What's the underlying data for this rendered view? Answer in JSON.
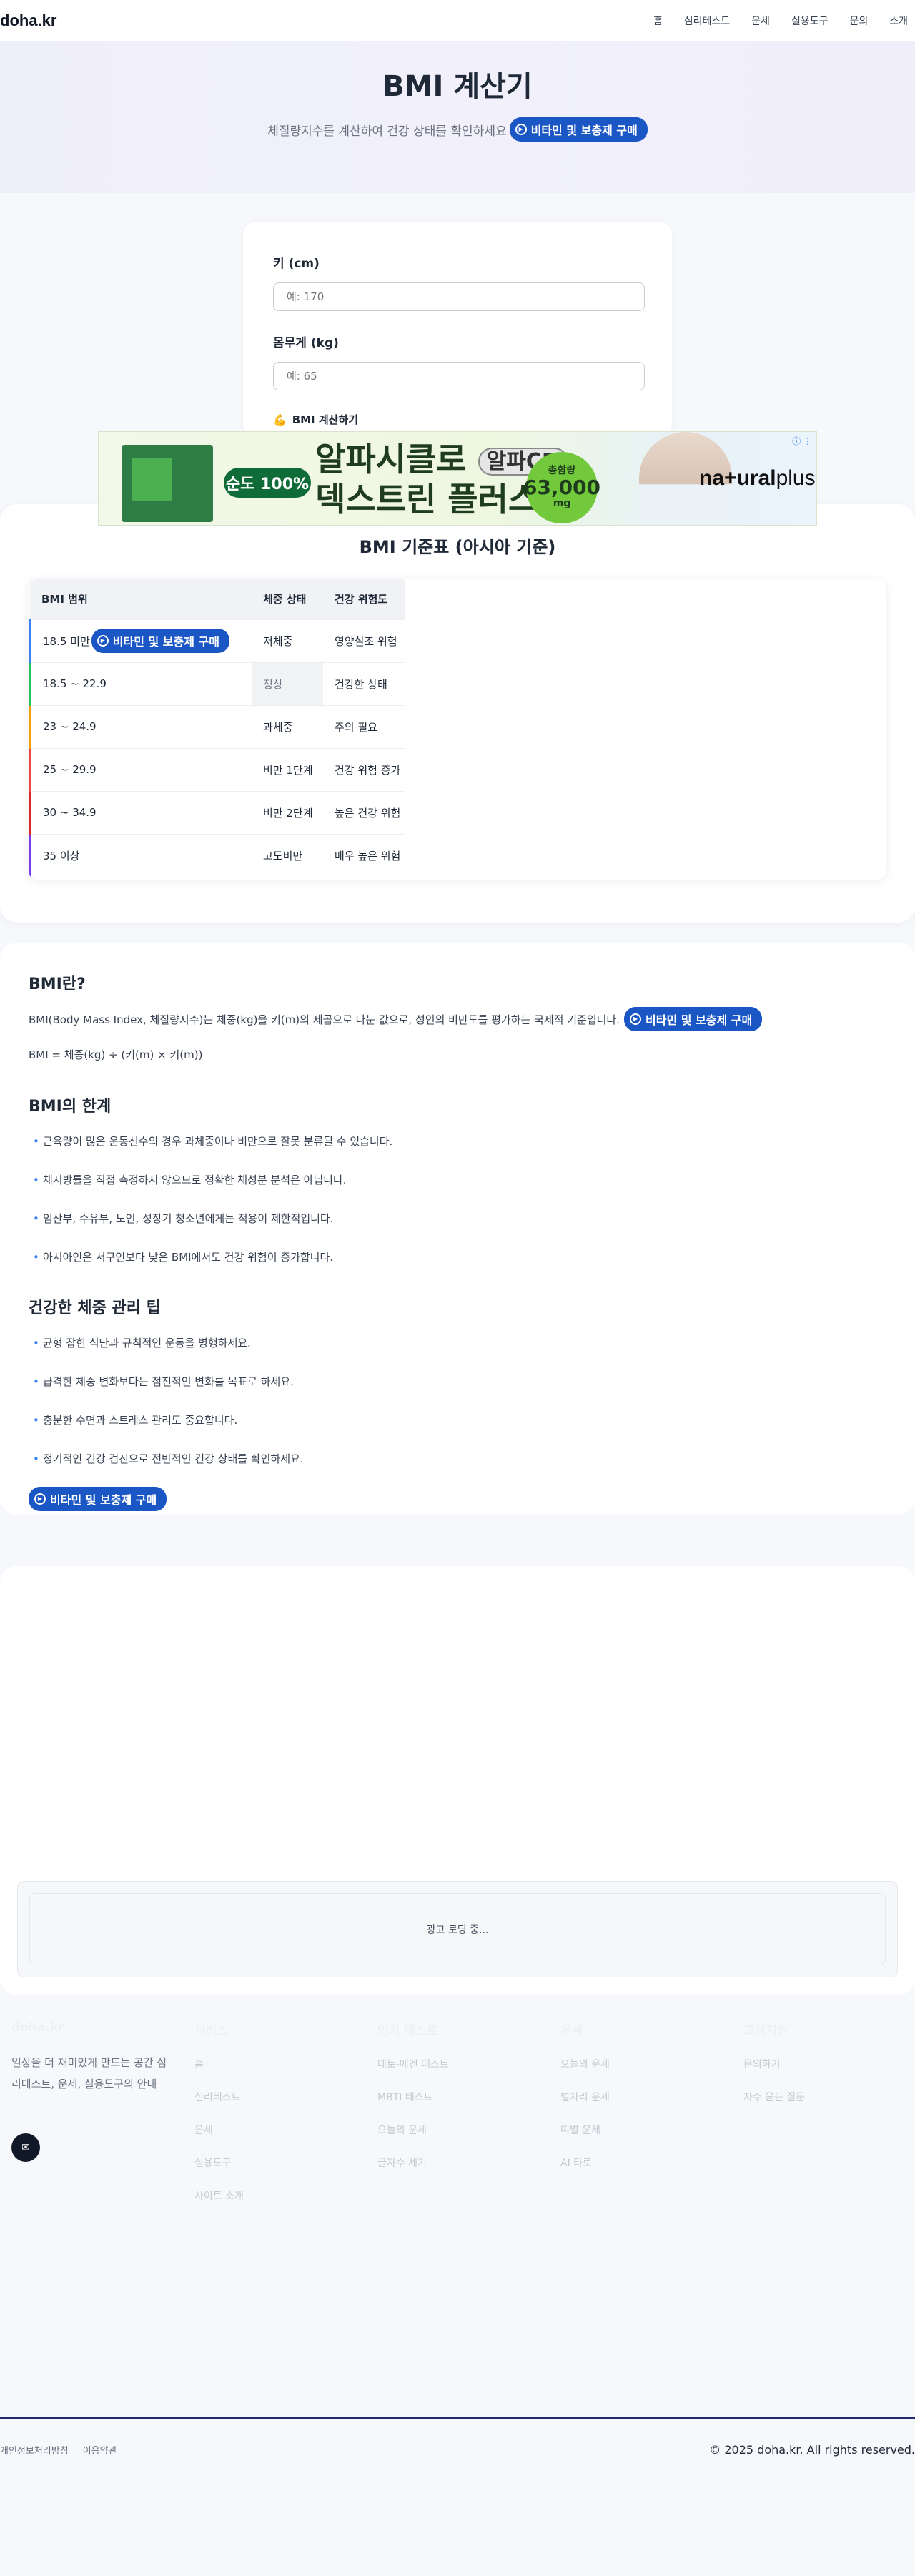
{
  "header": {
    "logo": "doha.kr",
    "nav": [
      "홈",
      "심리테스트",
      "운세",
      "실용도구",
      "문의",
      "소개"
    ]
  },
  "hero": {
    "title": "BMI 계산기",
    "subtitle": "체질량지수를 계산하여 건강 상태를 확인하세요",
    "promo_label": "비타민 및 보충제 구매"
  },
  "form": {
    "height_label": "키 (cm)",
    "height_placeholder": "예: 170",
    "weight_label": "몸무게 (kg)",
    "weight_placeholder": "예: 65",
    "calc_button": "BMI 계산하기",
    "calc_icon": "💪"
  },
  "ad_banner": {
    "purity": "순도 100%",
    "headline_line1": "알파시클로",
    "headline_cd": "알파CD",
    "headline_line2": "덱스트린 플러스",
    "badge_top": "총함량",
    "badge_value": "63,000",
    "badge_unit": "mg",
    "brand_a": "na",
    "brand_b": "+ural",
    "brand_c": "plus",
    "info_glyph": "ⓘ ⋮"
  },
  "table": {
    "title": "BMI 기준표 (아시아 기준)",
    "headers": [
      "BMI 범위",
      "체중 상태",
      "건강 위험도"
    ],
    "rows": [
      {
        "range": "18.5 미만",
        "status": "저체중",
        "risk": "영양실조 위험",
        "color": "#3b82f6"
      },
      {
        "range": "18.5 ~ 22.9",
        "status": "정상",
        "risk": "건강한 상태",
        "color": "#22c55e"
      },
      {
        "range": "23 ~ 24.9",
        "status": "과체중",
        "risk": "주의 필요",
        "color": "#f59e0b"
      },
      {
        "range": "25 ~ 29.9",
        "status": "비만 1단계",
        "risk": "건강 위험 증가",
        "color": "#ef4444"
      },
      {
        "range": "30 ~ 34.9",
        "status": "비만 2단계",
        "risk": "높은 건강 위험",
        "color": "#dc2626"
      },
      {
        "range": "35 이상",
        "status": "고도비만",
        "risk": "매우 높은 위험",
        "color": "#7c3aed"
      }
    ]
  },
  "info": {
    "what_title": "BMI란?",
    "what_text": "BMI(Body Mass Index, 체질량지수)는 체중(kg)을 키(m)의 제곱으로 나눈 값으로, 성인의 비만도를 평가하는 국제적 기준입니다.",
    "formula": "BMI = 체중(kg) ÷ (키(m) × 키(m))",
    "limits_title": "BMI의 한계",
    "limits": [
      "근육량이 많은 운동선수의 경우 과체중이나 비만으로 잘못 분류될 수 있습니다.",
      "체지방률을 직접 측정하지 않으므로 정확한 체성분 분석은 아닙니다.",
      "임산부, 수유부, 노인, 성장기 청소년에게는 적용이 제한적입니다.",
      "아시아인은 서구인보다 낮은 BMI에서도 건강 위험이 증가합니다."
    ],
    "tips_title": "건강한 체중 관리 팁",
    "tips": [
      "균형 잡힌 식단과 규칙적인 운동을 병행하세요.",
      "급격한 체중 변화보다는 점진적인 변화를 목표로 하세요.",
      "충분한 수면과 스트레스 관리도 중요합니다.",
      "정기적인 건강 검진으로 전반적인 건강 상태를 확인하세요."
    ]
  },
  "ad_area": {
    "loading": "광고 로딩 중..."
  },
  "footer": {
    "about_title": "doha.kr",
    "about_desc": "일상을 더 재미있게 만드는 공간 심리테스트, 운세, 실용도구의 안내",
    "chat_icon": "✉",
    "col2_title": "서비스",
    "col2_links": [
      "홈",
      "심리테스트",
      "운세",
      "실용도구",
      "사이트 소개"
    ],
    "col3_title": "인기 테스트",
    "col3_links": [
      "테토-에겐 테스트",
      "MBTI 테스트",
      "오늘의 운세",
      "글자수 세기"
    ],
    "col4_title": "운세",
    "col4_links": [
      "오늘의 운세",
      "별자리 운세",
      "띠별 운세",
      "AI 타로"
    ],
    "col5_title": "고객지원",
    "col5_links": [
      "문의하기",
      "자주 묻는 질문"
    ],
    "legal": [
      "개인정보처리방침",
      "이용약관"
    ],
    "copyright": "© 2025 doha.kr. All rights reserved."
  }
}
